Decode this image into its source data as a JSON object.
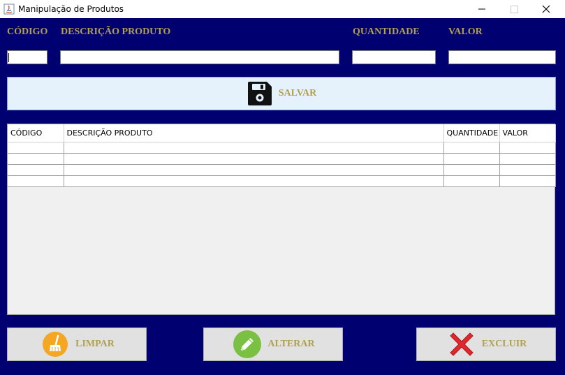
{
  "window": {
    "title": "Manipulação de Produtos"
  },
  "form": {
    "codigo_label": "CÓDIGO",
    "descricao_label": "DESCRIÇÃO PRODUTO",
    "quantidade_label": "QUANTIDADE",
    "valor_label": "VALOR",
    "codigo_value": "",
    "descricao_value": "",
    "quantidade_value": "",
    "valor_value": ""
  },
  "save_button": {
    "label": "SALVAR",
    "icon": "floppy-disk-icon"
  },
  "table": {
    "headers": [
      "CÓDIGO",
      "DESCRIÇÃO PRODUTO",
      "QUANTIDADE",
      "VALOR"
    ],
    "rows": [
      [
        "",
        "",
        "",
        ""
      ],
      [
        "",
        "",
        "",
        ""
      ],
      [
        "",
        "",
        "",
        ""
      ],
      [
        "",
        "",
        "",
        ""
      ]
    ]
  },
  "actions": {
    "limpar_label": "LIMPAR",
    "alterar_label": "ALTERAR",
    "excluir_label": "EXCLUIR"
  },
  "colors": {
    "background": "#000070",
    "label_gold": "#b0a050",
    "save_bg": "#e5f1fb",
    "limpar_icon": "#f5a623",
    "alterar_icon": "#7ac043",
    "excluir_icon": "#e0282c"
  }
}
